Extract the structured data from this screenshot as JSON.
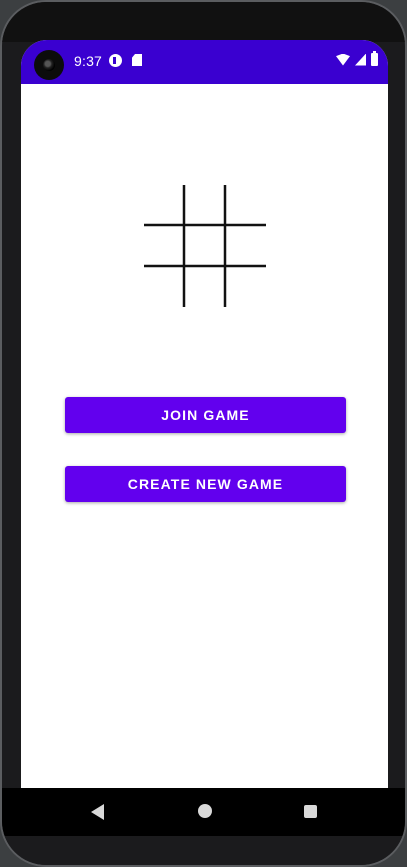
{
  "status_bar": {
    "time": "9:37",
    "background_color": "#3a00d0",
    "icons": [
      "notification-p-icon",
      "sd-card-icon",
      "wifi-icon",
      "signal-icon",
      "battery-icon"
    ]
  },
  "main": {
    "logo_icon": "tic-tac-toe-grid-icon",
    "join_button_label": "JOIN GAME",
    "create_button_label": "CREATE NEW GAME",
    "accent_color": "#6200ee"
  },
  "nav_bar": {
    "icons": [
      "back-icon",
      "home-icon",
      "recents-icon"
    ]
  }
}
